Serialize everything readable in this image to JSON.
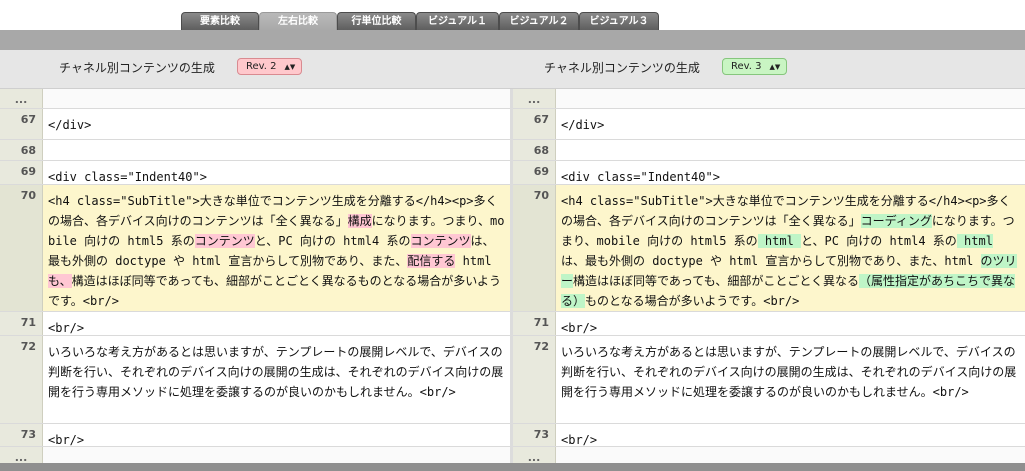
{
  "tabs": [
    {
      "label": "要素比較",
      "active": false
    },
    {
      "label": "左右比較",
      "active": true
    },
    {
      "label": "行単位比較",
      "active": false
    },
    {
      "label": "ビジュアル１",
      "active": false
    },
    {
      "label": "ビジュアル２",
      "active": false
    },
    {
      "label": "ビジュアル３",
      "active": false
    }
  ],
  "left": {
    "title": "チャネル別コンテンツの生成",
    "revision": "Rev. 2",
    "revision_color": "#ffc8cc",
    "lines": {
      "dots_top": "...",
      "n67": "67",
      "t67": "</div>",
      "n68": "68",
      "t68": "",
      "n69": "69",
      "t69": "<div class=\"Indent40\">",
      "n70": "70",
      "t70_a": "<h4 class=\"SubTitle\">大きな単位でコンテンツ生成を分離する</h4><p>多くの場合、各デバイス向けのコンテンツは「全く異なる」",
      "t70_d1": "構成",
      "t70_b": "になります。つまり、mobile 向けの html5 系の",
      "t70_d2": "コンテンツ",
      "t70_c": "と、PC 向けの html4 系の",
      "t70_d3": "コンテンツ",
      "t70_e": "は、最も外側の doctype や html 宣言からして別物であり、また、",
      "t70_d4": "配信する",
      "t70_f": " html ",
      "t70_d5": "も、",
      "t70_g": "構造はほぼ同等であっても、細部がことごとく異なるものとなる場合が多いようです。<br/>",
      "n71": "71",
      "t71": "<br/>",
      "n72": "72",
      "t72": "いろいろな考え方があるとは思いますが、テンプレートの展開レベルで、デバイスの判断を行い、それぞれのデバイス向けの展開の生成は、それぞれのデバイス向けの展開を行う専用メソッドに処理を委譲するのが良いのかもしれません。<br/>",
      "n73": "73",
      "t73": "<br/>",
      "dots_bottom": "..."
    }
  },
  "right": {
    "title": "チャネル別コンテンツの生成",
    "revision": "Rev. 3",
    "revision_color": "#c9f5c3",
    "lines": {
      "dots_top": "...",
      "n67": "67",
      "t67": "</div>",
      "n68": "68",
      "t68": "",
      "n69": "69",
      "t69": "<div class=\"Indent40\">",
      "n70": "70",
      "t70_a": "<h4 class=\"SubTitle\">大きな単位でコンテンツ生成を分離する</h4><p>多くの場合、各デバイス向けのコンテンツは「全く異なる」",
      "t70_i1": "コーディング",
      "t70_b": "になります。つまり、mobile 向けの html5 系の",
      "t70_i2": " html ",
      "t70_c": "と、PC 向けの html4 系の",
      "t70_i3": " html ",
      "t70_e": "は、最も外側の doctype や html 宣言からして別物であり、また、html ",
      "t70_i4": "のツリー",
      "t70_f": "構造はほぼ同等であっても、細部がことごとく異なる",
      "t70_i5": "（属性指定があちこちで異なる）",
      "t70_g": "ものとなる場合が多いようです。<br/>",
      "n71": "71",
      "t71": "<br/>",
      "n72": "72",
      "t72": "いろいろな考え方があるとは思いますが、テンプレートの展開レベルで、デバイスの判断を行い、それぞれのデバイス向けの展開の生成は、それぞれのデバイス向けの展開を行う専用メソッドに処理を委譲するのが良いのかもしれません。<br/>",
      "n73": "73",
      "t73": "<br/>",
      "dots_bottom": "..."
    }
  }
}
